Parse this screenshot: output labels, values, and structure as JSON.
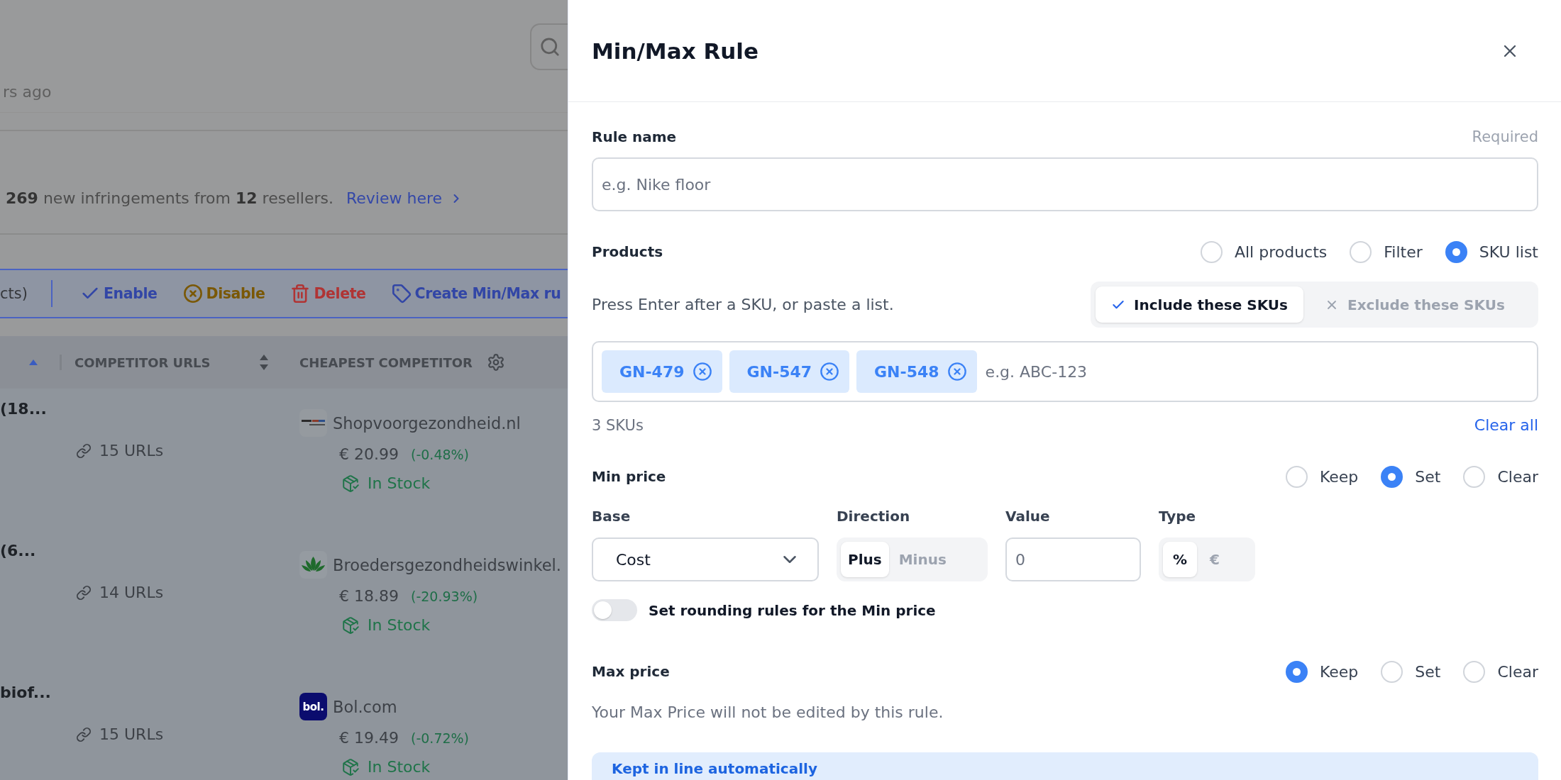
{
  "backdrop": {
    "updated": "rs ago",
    "banner": {
      "text": "**269** new infringements from **12** resellers.",
      "link": "Review here"
    },
    "bulk_bar": {
      "selection": "cts)",
      "actions": [
        {
          "kind": "enable",
          "label": "Enable"
        },
        {
          "kind": "disable",
          "label": "Disable"
        },
        {
          "kind": "delete",
          "label": "Delete"
        },
        {
          "kind": "rule",
          "label": "Create Min/Max ru"
        }
      ]
    },
    "table": {
      "columns": [
        {
          "kind": "sortable",
          "sorted": true
        },
        {
          "kind": "sortable",
          "label": "COMPETITOR URLS",
          "sorted": false
        },
        {
          "kind": "settings",
          "label": "CHEAPEST COMPETITOR"
        }
      ],
      "rows": [
        {
          "product": "(18...",
          "urls": "15 URLs",
          "competitor": {
            "logo": {
              "kind": "stripes"
            },
            "name": "Shopvoorgezondheid.nl",
            "price": "€ 20.99",
            "change": "(-0.48%)",
            "stock": "In Stock"
          }
        },
        {
          "product": "(6...",
          "urls": "14 URLs",
          "competitor": {
            "logo": {
              "kind": "leaf"
            },
            "name": "Broedersgezondheidswinkel.",
            "price": "€ 18.89",
            "change": "(-20.93%)",
            "stock": "In Stock"
          }
        },
        {
          "product": "biof...",
          "urls": "15 URLs",
          "competitor": {
            "logo": {
              "kind": "tile",
              "text": "bol."
            },
            "name": "Bol.com",
            "price": "€ 19.49",
            "change": "(-0.72%)",
            "stock": "In Stock"
          }
        }
      ]
    }
  },
  "drawer": {
    "title": "Min/Max Rule",
    "rule_name": {
      "label": "Rule name",
      "hint": "Required",
      "placeholder": "e.g. Nike floor"
    },
    "products": {
      "label": "Products",
      "options": [
        {
          "label": "All products",
          "selected": false
        },
        {
          "label": "Filter",
          "selected": false
        },
        {
          "label": "SKU list",
          "selected": true
        }
      ],
      "help": "Press Enter after a SKU, or paste a list.",
      "modes": [
        {
          "kind": "include",
          "label": "Include these SKUs",
          "selected": true
        },
        {
          "kind": "exclude",
          "label": "Exclude these SKUs",
          "selected": false
        }
      ],
      "skus": [
        "GN-479",
        "GN-547",
        "GN-548"
      ],
      "sku_placeholder": "e.g. ABC-123",
      "count": "3 SKUs",
      "clear": "Clear all"
    },
    "min_price": {
      "label": "Min price",
      "options": [
        {
          "label": "Keep",
          "selected": false
        },
        {
          "label": "Set",
          "selected": true
        },
        {
          "label": "Clear",
          "selected": false
        }
      ],
      "base": {
        "label": "Base",
        "value": "Cost"
      },
      "direction": {
        "label": "Direction",
        "options": [
          {
            "label": "Plus",
            "selected": true
          },
          {
            "label": "Minus",
            "selected": false
          }
        ]
      },
      "value": {
        "label": "Value",
        "placeholder": "0"
      },
      "type": {
        "label": "Type",
        "options": [
          {
            "label": "%",
            "selected": true
          },
          {
            "label": "€",
            "selected": false
          }
        ]
      },
      "rounding": {
        "label": "Set rounding rules for the Min price",
        "on": false
      }
    },
    "max_price": {
      "label": "Max price",
      "options": [
        {
          "label": "Keep",
          "selected": true
        },
        {
          "label": "Set",
          "selected": false
        },
        {
          "label": "Clear",
          "selected": false
        }
      ],
      "note": "Your Max Price will not be edited by this rule."
    },
    "info": {
      "title": "Kept in line automatically"
    }
  }
}
